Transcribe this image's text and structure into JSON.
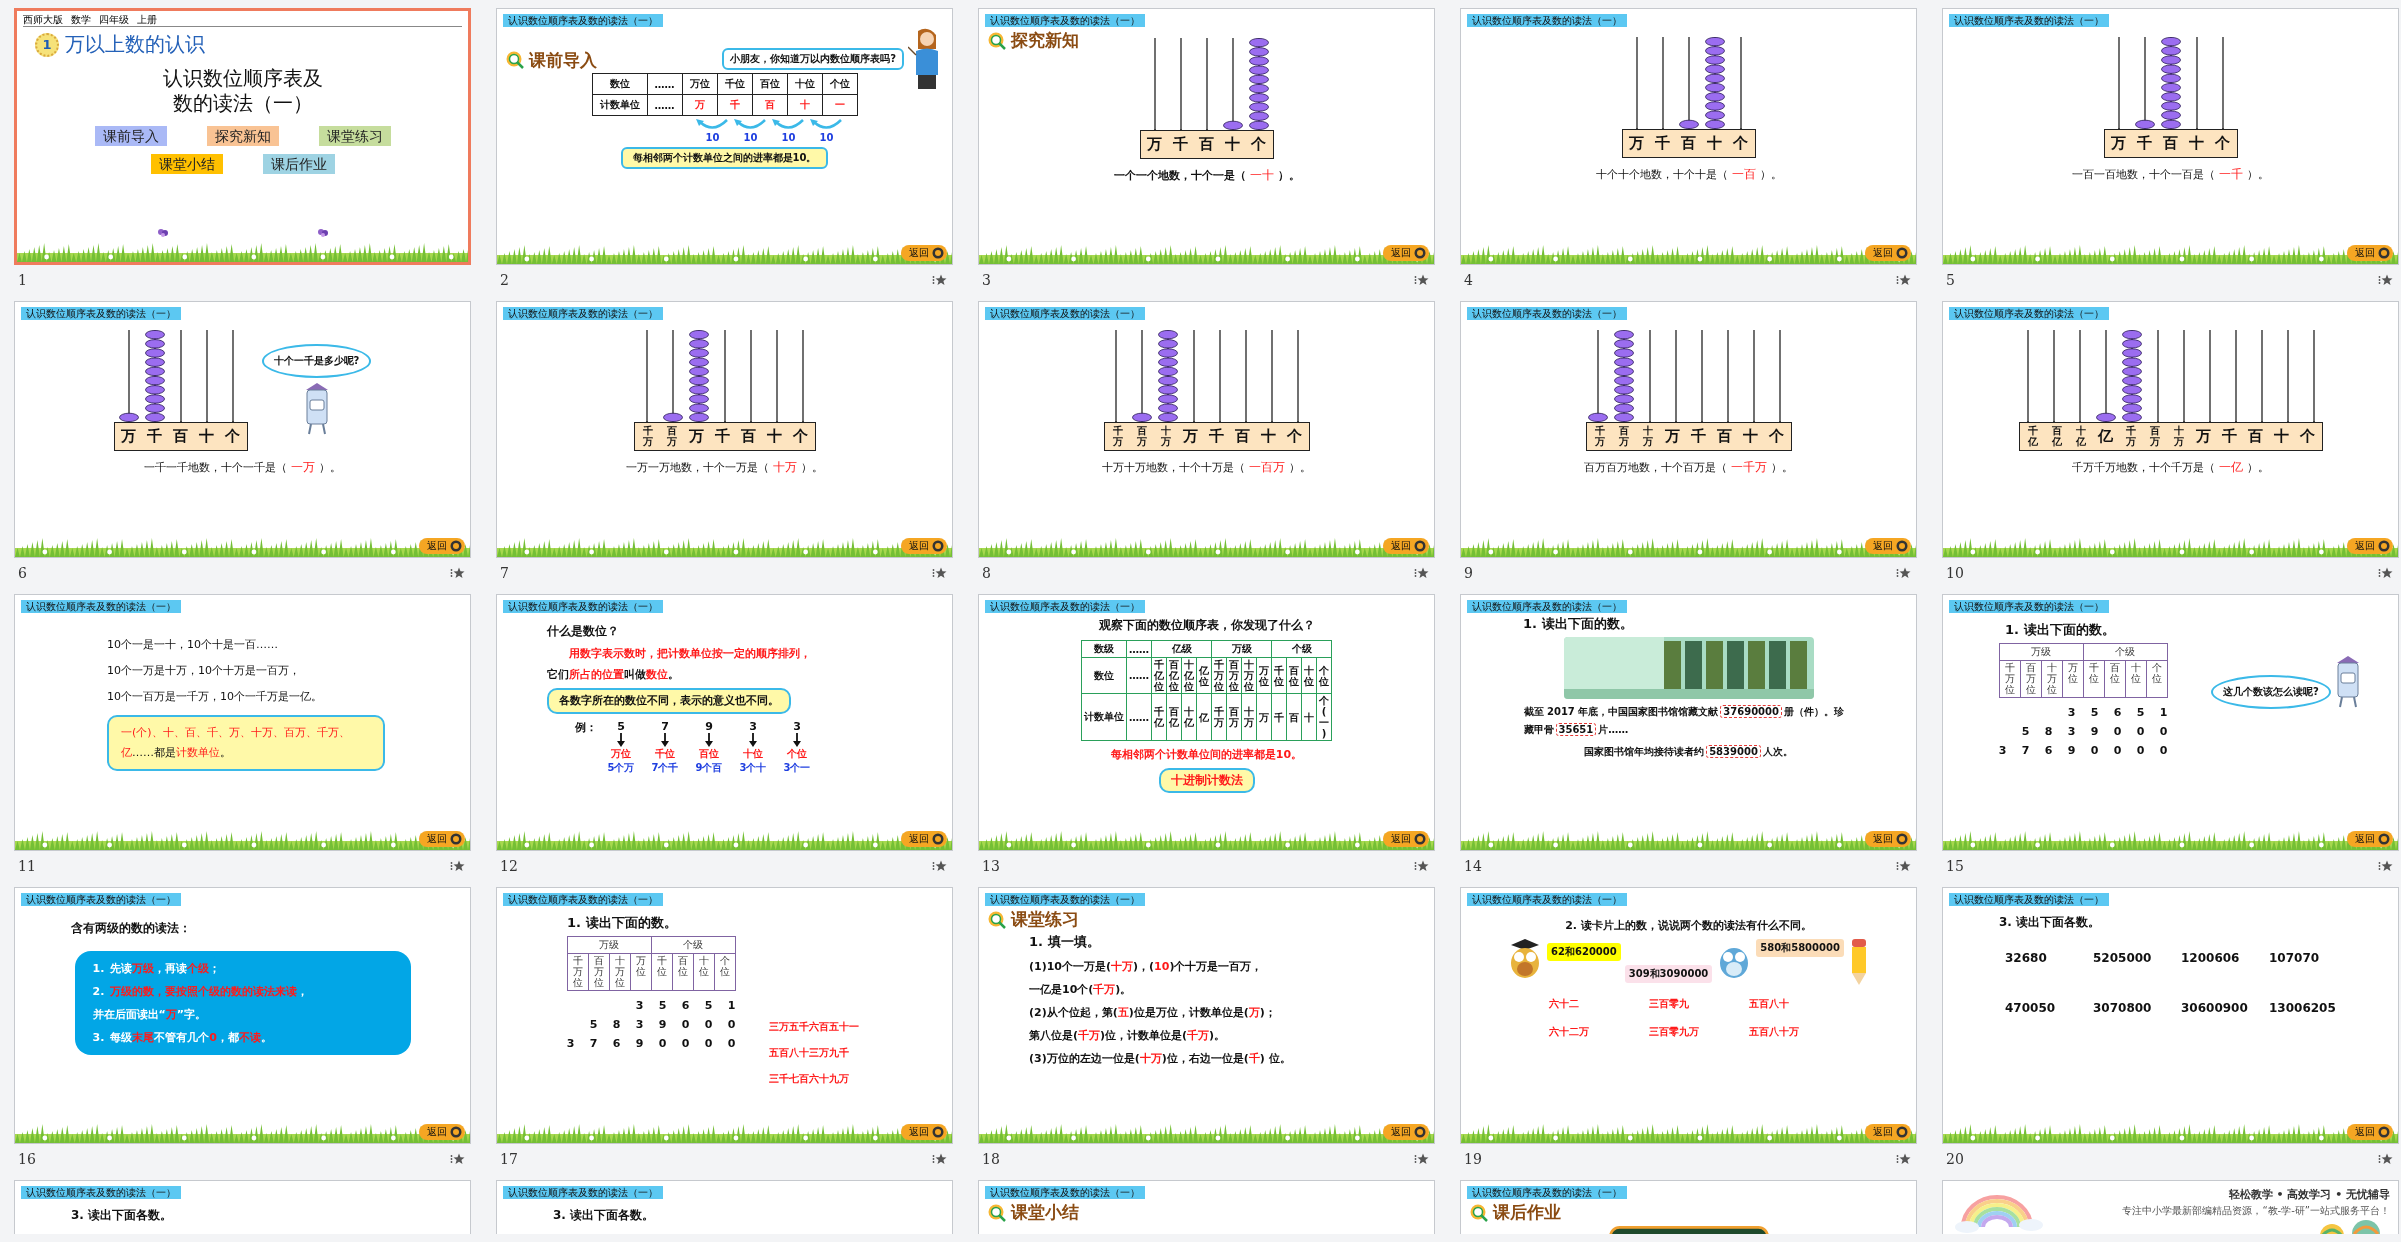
{
  "slides": [
    {
      "number": "1",
      "selected": true,
      "starred": false,
      "kind": "cover",
      "meta": [
        "西师大版",
        "数学",
        "四年级",
        "上册"
      ],
      "badge": "1",
      "title": "万以上数的认识",
      "subtitle": [
        "认识数位顺序表及",
        "数的读法（一）"
      ],
      "links": [
        {
          "label": "课前导入",
          "color": "#aab9f6"
        },
        {
          "label": "探究新知",
          "color": "#f9c394"
        },
        {
          "label": "课堂练习",
          "color": "#c6dd9d"
        },
        {
          "label": "课堂小结",
          "color": "#ffc000"
        },
        {
          "label": "课后作业",
          "color": "#9ed3e3"
        }
      ]
    },
    {
      "number": "2",
      "selected": false,
      "starred": true,
      "kind": "intro",
      "header": "认识数位顺序表及数的读法（一）",
      "section": "课前导入",
      "bubble": "小朋友，你知道万以内数位顺序表吗?",
      "table": [
        {
          "head": "数位",
          "gap": "……",
          "cells": [
            "万位",
            "千位",
            "百位",
            "十位",
            "个位"
          ],
          "highlight": false
        },
        {
          "head": "计数单位",
          "gap": "……",
          "cells": [
            "万",
            "千",
            "百",
            "十",
            "一"
          ],
          "highlight": true
        }
      ],
      "arrows": [
        "10",
        "10",
        "10",
        "10"
      ],
      "note": "每相邻两个计数单位之间的进率都是10。",
      "back": "返回"
    },
    {
      "number": "3",
      "selected": false,
      "starred": true,
      "kind": "abacus",
      "header": "认识数位顺序表及数的读法（一）",
      "section": "探究新知",
      "bold": true,
      "rods": [
        {
          "label": "万",
          "level": 0
        },
        {
          "label": "千",
          "level": 0
        },
        {
          "label": "百",
          "level": 0
        },
        {
          "label": "十",
          "level": 0.1
        },
        {
          "label": "个",
          "level": 1
        }
      ],
      "sentence": {
        "before": "一个一个地数，十个一是（",
        "answer": "一十",
        "after": "）。"
      },
      "back": "返回"
    },
    {
      "number": "4",
      "selected": false,
      "starred": true,
      "kind": "abacus",
      "header": "认识数位顺序表及数的读法（一）",
      "bold": false,
      "rods": [
        {
          "label": "万",
          "level": 0
        },
        {
          "label": "千",
          "level": 0
        },
        {
          "label": "百",
          "level": 0.1
        },
        {
          "label": "十",
          "level": 1
        },
        {
          "label": "个",
          "level": 0
        }
      ],
      "sentence": {
        "before": "十个十个地数，十个十是（",
        "answer": "一百",
        "after": "）。"
      },
      "back": "返回"
    },
    {
      "number": "5",
      "selected": false,
      "starred": true,
      "kind": "abacus",
      "header": "认识数位顺序表及数的读法（一）",
      "bold": false,
      "rods": [
        {
          "label": "万",
          "level": 0
        },
        {
          "label": "千",
          "level": 0.1
        },
        {
          "label": "百",
          "level": 1
        },
        {
          "label": "十",
          "level": 0
        },
        {
          "label": "个",
          "level": 0
        }
      ],
      "sentence": {
        "before": "一百一百地数，十个一百是（",
        "answer": "一千",
        "after": "）。"
      },
      "back": "返回"
    },
    {
      "number": "6",
      "selected": false,
      "starred": true,
      "kind": "abacus",
      "header": "认识数位顺序表及数的读法（一）",
      "bold": false,
      "bubble": "十个一千是多少呢?",
      "rods": [
        {
          "label": "万",
          "level": 0.1
        },
        {
          "label": "千",
          "level": 1
        },
        {
          "label": "百",
          "level": 0
        },
        {
          "label": "十",
          "level": 0
        },
        {
          "label": "个",
          "level": 0
        }
      ],
      "sentence": {
        "before": "一千一千地数，十个一千是（",
        "answer": "一万",
        "after": "）。"
      },
      "back": "返回"
    },
    {
      "number": "7",
      "selected": false,
      "starred": true,
      "kind": "abacus",
      "header": "认识数位顺序表及数的读法（一）",
      "bold": false,
      "rods": [
        {
          "label": "千万",
          "level": 0
        },
        {
          "label": "百万",
          "level": 0.1
        },
        {
          "label": "万",
          "level": 1
        },
        {
          "label": "千",
          "level": 0
        },
        {
          "label": "百",
          "level": 0
        },
        {
          "label": "十",
          "level": 0
        },
        {
          "label": "个",
          "level": 0
        }
      ],
      "sentence": {
        "before": "一万一万地数，十个一万是（",
        "answer": "十万",
        "after": "）。"
      },
      "back": "返回"
    },
    {
      "number": "8",
      "selected": false,
      "starred": true,
      "kind": "abacus",
      "header": "认识数位顺序表及数的读法（一）",
      "bold": false,
      "rods": [
        {
          "label": "千万",
          "level": 0
        },
        {
          "label": "百万",
          "level": 0.1
        },
        {
          "label": "十万",
          "level": 1
        },
        {
          "label": "万",
          "level": 0
        },
        {
          "label": "千",
          "level": 0
        },
        {
          "label": "百",
          "level": 0
        },
        {
          "label": "十",
          "level": 0
        },
        {
          "label": "个",
          "level": 0
        }
      ],
      "sentence": {
        "before": "十万十万地数，十个十万是（",
        "answer": "一百万",
        "after": "）。"
      },
      "back": "返回"
    },
    {
      "number": "9",
      "selected": false,
      "starred": true,
      "kind": "abacus",
      "header": "认识数位顺序表及数的读法（一）",
      "bold": false,
      "rods": [
        {
          "label": "千万",
          "level": 0.1
        },
        {
          "label": "百万",
          "level": 1
        },
        {
          "label": "十万",
          "level": 0
        },
        {
          "label": "万",
          "level": 0
        },
        {
          "label": "千",
          "level": 0
        },
        {
          "label": "百",
          "level": 0
        },
        {
          "label": "十",
          "level": 0
        },
        {
          "label": "个",
          "level": 0
        }
      ],
      "sentence": {
        "before": "百万百万地数，十个百万是（",
        "answer": "一千万",
        "after": "）。"
      },
      "back": "返回"
    },
    {
      "number": "10",
      "selected": false,
      "starred": true,
      "kind": "abacus",
      "header": "认识数位顺序表及数的读法（一）",
      "bold": false,
      "rods": [
        {
          "label": "千亿",
          "level": 0
        },
        {
          "label": "百亿",
          "level": 0
        },
        {
          "label": "十亿",
          "level": 0
        },
        {
          "label": "亿",
          "level": 0.1
        },
        {
          "label": "千万",
          "level": 1
        },
        {
          "label": "百万",
          "level": 0
        },
        {
          "label": "十万",
          "level": 0
        },
        {
          "label": "万",
          "level": 0
        },
        {
          "label": "千",
          "level": 0
        },
        {
          "label": "百",
          "level": 0
        },
        {
          "label": "十",
          "level": 0
        },
        {
          "label": "个",
          "level": 0
        }
      ],
      "sentence": {
        "before": "千万千万地数，十个千万是（",
        "answer": "一亿",
        "after": "）。"
      },
      "back": "返回"
    },
    {
      "number": "11",
      "selected": false,
      "starred": true,
      "kind": "lines",
      "header": "认识数位顺序表及数的读法（一）",
      "lines": [
        "10个一是一十，10个十是一百……",
        "10个一万是十万，10个十万是一百万，",
        "10个一百万是一千万，10个一千万是一亿。"
      ],
      "box": [
        {
          "text": "一(个)、十、百、千、万、十万、百万、千万、亿",
          "highlight": true
        },
        {
          "text": "……都是",
          "highlight": false
        },
        {
          "text": "计数单位",
          "highlight": true
        },
        {
          "text": "。",
          "highlight": false
        }
      ],
      "back": "返回"
    },
    {
      "number": "12",
      "selected": false,
      "starred": true,
      "kind": "place",
      "header": "认识数位顺序表及数的读法（一）",
      "question": "什么是数位？",
      "lead": "用数字表示数时，把计数单位按一定的顺序排列，",
      "line": [
        {
          "text": "它们",
          "highlight": false
        },
        {
          "text": "所占的位置",
          "highlight": true
        },
        {
          "text": "叫做",
          "highlight": false
        },
        {
          "text": "数位",
          "highlight": true
        },
        {
          "text": "。",
          "highlight": false
        }
      ],
      "box": "各数字所在的数位不同，表示的意义也不同。",
      "example": "例：",
      "digits": [
        {
          "digit": "5",
          "place": "万位",
          "meaning": "5个万"
        },
        {
          "digit": "7",
          "place": "千位",
          "meaning": "7个千"
        },
        {
          "digit": "9",
          "place": "百位",
          "meaning": "9个百"
        },
        {
          "digit": "3",
          "place": "十位",
          "meaning": "3个十"
        },
        {
          "digit": "3",
          "place": "个位",
          "meaning": "3个一"
        }
      ],
      "back": "返回"
    },
    {
      "number": "13",
      "selected": false,
      "starred": true,
      "kind": "order",
      "header": "认识数位顺序表及数的读法（一）",
      "question": "观察下面的数位顺序表，你发现了什么？",
      "heads": [
        "数级",
        "数位",
        "计数单位"
      ],
      "gaps": [
        "……",
        "……",
        "……"
      ],
      "groups": [
        {
          "name": "亿级",
          "places": [
            "千亿位",
            "百亿位",
            "十亿位",
            "亿位"
          ],
          "units": [
            "千亿",
            "百亿",
            "十亿",
            "亿"
          ]
        },
        {
          "name": "万级",
          "places": [
            "千万位",
            "百万位",
            "十万位",
            "万位"
          ],
          "units": [
            "千万",
            "百万",
            "十万",
            "万"
          ]
        },
        {
          "name": "个级",
          "places": [
            "千位",
            "百位",
            "十位",
            "个位"
          ],
          "units": [
            "千",
            "百",
            "十",
            "个(一)"
          ]
        }
      ],
      "note": "每相邻两个计数单位间的进率都是10。",
      "button": "十进制计数法",
      "back": "返回"
    },
    {
      "number": "14",
      "selected": false,
      "starred": true,
      "kind": "library",
      "header": "认识数位顺序表及数的读法（一）",
      "title": "1. 读出下面的数。",
      "paragraphs": [
        [
          {
            "text": "截至 2017 年底，中国国家图书馆馆藏文献",
            "boxed": false
          },
          {
            "text": "37690000",
            "boxed": true
          },
          {
            "text": "册（件）。珍藏甲骨",
            "boxed": false
          },
          {
            "text": "35651",
            "boxed": true
          },
          {
            "text": "片……",
            "boxed": false
          }
        ],
        [
          {
            "text": "国家图书馆年均接待读者约",
            "boxed": false
          },
          {
            "text": "5839000",
            "boxed": true
          },
          {
            "text": "人次。",
            "boxed": false
          }
        ]
      ],
      "back": "返回"
    },
    {
      "number": "15",
      "selected": false,
      "starred": true,
      "kind": "readtable",
      "header": "认识数位顺序表及数的读法（一）",
      "title": "1. 读出下面的数。",
      "groups": [
        {
          "name": "万级",
          "places": [
            "千万位",
            "百万位",
            "十万位",
            "万位"
          ]
        },
        {
          "name": "个级",
          "places": [
            "千位",
            "百位",
            "十位",
            "个位"
          ]
        }
      ],
      "rows": [
        [
          "",
          "",
          "",
          "3",
          "5",
          "6",
          "5",
          "1"
        ],
        [
          "",
          "5",
          "8",
          "3",
          "9",
          "0",
          "0",
          "0"
        ],
        [
          "3",
          "7",
          "6",
          "9",
          "0",
          "0",
          "0",
          "0"
        ]
      ],
      "bubble": "这几个数该怎么读呢?",
      "back": "返回"
    },
    {
      "number": "16",
      "selected": false,
      "starred": true,
      "kind": "rules",
      "header": "认识数位顺序表及数的读法（一）",
      "title": "含有两级的数的读法：",
      "items": [
        {
          "marker": "1.",
          "lines": [
            [
              {
                "text": "先读",
                "highlight": false
              },
              {
                "text": "万级",
                "highlight": true
              },
              {
                "text": "，再读",
                "highlight": false
              },
              {
                "text": "个级",
                "highlight": true
              },
              {
                "text": "；",
                "highlight": false
              }
            ]
          ]
        },
        {
          "marker": "2.",
          "lines": [
            [
              {
                "text": "万级的数，要按照个级的数的读法来读",
                "highlight": true
              },
              {
                "text": "，",
                "highlight": false
              }
            ],
            [
              {
                "text": "并在后面读出“",
                "highlight": false
              },
              {
                "text": "万",
                "highlight": true
              },
              {
                "text": "”字。",
                "highlight": false
              }
            ]
          ]
        },
        {
          "marker": "3.",
          "lines": [
            [
              {
                "text": "每级",
                "highlight": false
              },
              {
                "text": "末尾",
                "highlight": true
              },
              {
                "text": "不管有几个",
                "highlight": false
              },
              {
                "text": "0",
                "highlight": true
              },
              {
                "text": "，都",
                "highlight": false
              },
              {
                "text": "不读",
                "highlight": true
              },
              {
                "text": "。",
                "highlight": false
              }
            ]
          ]
        }
      ],
      "back": "返回"
    },
    {
      "number": "17",
      "selected": false,
      "starred": true,
      "kind": "readtable",
      "header": "认识数位顺序表及数的读法（一）",
      "title": "1. 读出下面的数。",
      "groups": [
        {
          "name": "万级",
          "places": [
            "千万位",
            "百万位",
            "十万位",
            "万位"
          ]
        },
        {
          "name": "个级",
          "places": [
            "千位",
            "百位",
            "十位",
            "个位"
          ]
        }
      ],
      "rows": [
        [
          "",
          "",
          "",
          "3",
          "5",
          "6",
          "5",
          "1"
        ],
        [
          "",
          "5",
          "8",
          "3",
          "9",
          "0",
          "0",
          "0"
        ],
        [
          "3",
          "7",
          "6",
          "9",
          "0",
          "0",
          "0",
          "0"
        ]
      ],
      "readings": [
        "三万五千六百五十一",
        "五百八十三万九千",
        "三千七百六十九万"
      ],
      "back": "返回"
    },
    {
      "number": "18",
      "selected": false,
      "starred": true,
      "kind": "fill",
      "header": "认识数位顺序表及数的读法（一）",
      "section": "课堂练习",
      "title": "1. 填一填。",
      "lines": [
        [
          {
            "text": "(1)10个一万是(",
            "highlight": false
          },
          {
            "text": "十万",
            "highlight": true
          },
          {
            "text": ")，(",
            "highlight": false
          },
          {
            "text": "10",
            "highlight": true
          },
          {
            "text": ")个十万是一百万，",
            "highlight": false
          }
        ],
        [
          {
            "text": "一亿是10个(",
            "highlight": false
          },
          {
            "text": "千万",
            "highlight": true
          },
          {
            "text": ")。",
            "highlight": false
          }
        ],
        [
          {
            "text": "(2)从个位起，第(",
            "highlight": false
          },
          {
            "text": "五",
            "highlight": true
          },
          {
            "text": ")位是万位，计数单位是(",
            "highlight": false
          },
          {
            "text": "万",
            "highlight": true
          },
          {
            "text": ")；",
            "highlight": false
          }
        ],
        [
          {
            "text": "第八位是(",
            "highlight": false
          },
          {
            "text": "千万",
            "highlight": true
          },
          {
            "text": ")位，计数单位是(",
            "highlight": false
          },
          {
            "text": "千万",
            "highlight": true
          },
          {
            "text": ")。",
            "highlight": false
          }
        ],
        [
          {
            "text": "(3)万位的左边一位是(",
            "highlight": false
          },
          {
            "text": "十万",
            "highlight": true
          },
          {
            "text": ")位，右边一位是(",
            "highlight": false
          },
          {
            "text": "千",
            "highlight": true
          },
          {
            "text": ") 位。",
            "highlight": false
          }
        ]
      ],
      "back": "返回"
    },
    {
      "number": "19",
      "selected": false,
      "starred": true,
      "kind": "cards",
      "header": "认识数位顺序表及数的读法（一）",
      "title": "2. 读卡片上的数，说说两个数的读法有什么不同。",
      "cards": [
        {
          "text": "62和620000",
          "color": "#ffff00"
        },
        {
          "text": "309和3090000",
          "color": "#fbe1ea"
        },
        {
          "text": "580和5800000",
          "color": "#fbdcb8"
        }
      ],
      "readings": [
        [
          "六十二",
          "六十二万"
        ],
        [
          "三百零九",
          "三百零九万"
        ],
        [
          "五百八十",
          "五百八十万"
        ]
      ],
      "back": "返回"
    },
    {
      "number": "20",
      "selected": false,
      "starred": true,
      "kind": "numbers",
      "header": "认识数位顺序表及数的读法（一）",
      "title": "3. 读出下面各数。",
      "numbers": [
        "32680",
        "5205000",
        "1200606",
        "107070",
        "470050",
        "3070800",
        "30600900",
        "13006205"
      ],
      "back": "返回"
    },
    {
      "selected": false,
      "kind": "numbers",
      "header": "认识数位顺序表及数的读法（一）",
      "title": "3. 读出下面各数。"
    },
    {
      "selected": false,
      "kind": "numbers",
      "header": "认识数位顺序表及数的读法（一）",
      "title": "3. 读出下面各数。"
    },
    {
      "selected": false,
      "kind": "section",
      "header": "认识数位顺序表及数的读法（一）",
      "section": "课堂小结"
    },
    {
      "selected": false,
      "kind": "homework",
      "header": "认识数位顺序表及数的读法（一）",
      "section": "课后作业"
    },
    {
      "selected": false,
      "kind": "ending",
      "slogan": "轻松教学 • 高效学习 • 无忧辅导",
      "tagline": "专注中小学最新部编精品资源，“教-学-研”一站式服务平台！"
    }
  ]
}
